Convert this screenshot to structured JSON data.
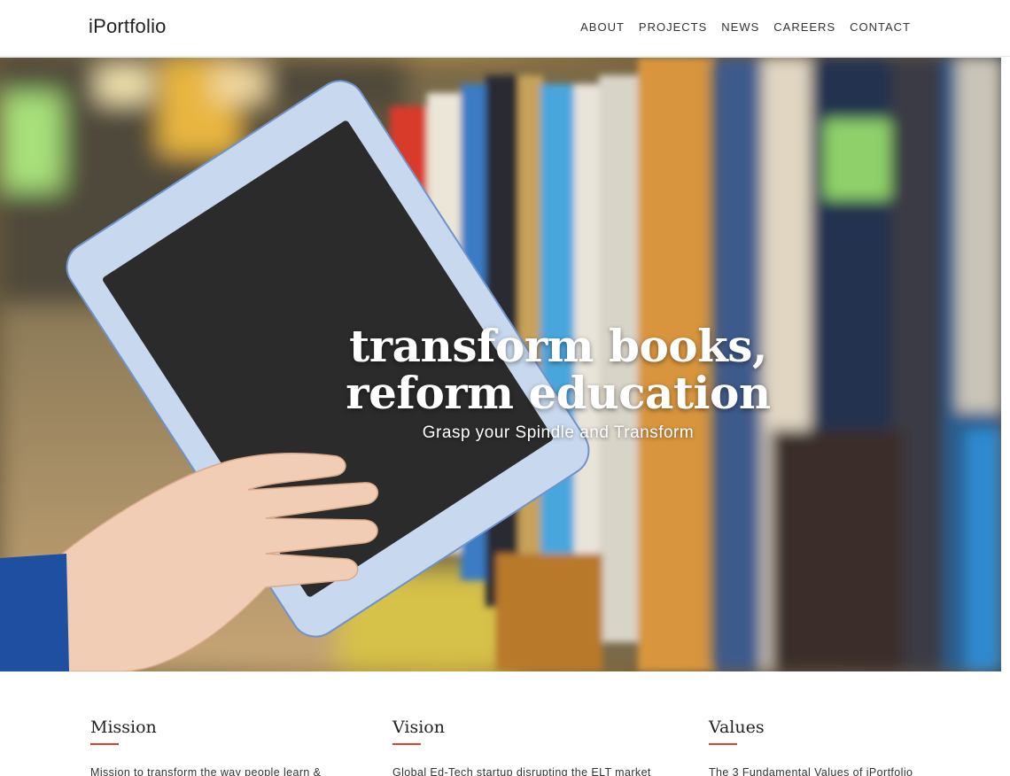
{
  "header": {
    "brand": "iPortfolio",
    "nav": [
      {
        "label": "ABOUT"
      },
      {
        "label": "PROJECTS"
      },
      {
        "label": "NEWS"
      },
      {
        "label": "CAREERS"
      },
      {
        "label": "CONTACT"
      }
    ]
  },
  "hero": {
    "title": "transform books,\nreform education",
    "subtitle": "Grasp your Spindle and Transform"
  },
  "sections": [
    {
      "heading": "Mission",
      "text": "Mission to transform the way people learn &"
    },
    {
      "heading": "Vision",
      "text": "Global Ed-Tech startup disrupting the ELT market"
    },
    {
      "heading": "Values",
      "text": "The 3 Fundamental Values of iPortfolio"
    }
  ],
  "colors": {
    "accent": "#d9412b",
    "tablet_frame": "#c8d8ee",
    "tablet_screen": "#2b2b2b",
    "sleeve": "#1f4fa0"
  }
}
